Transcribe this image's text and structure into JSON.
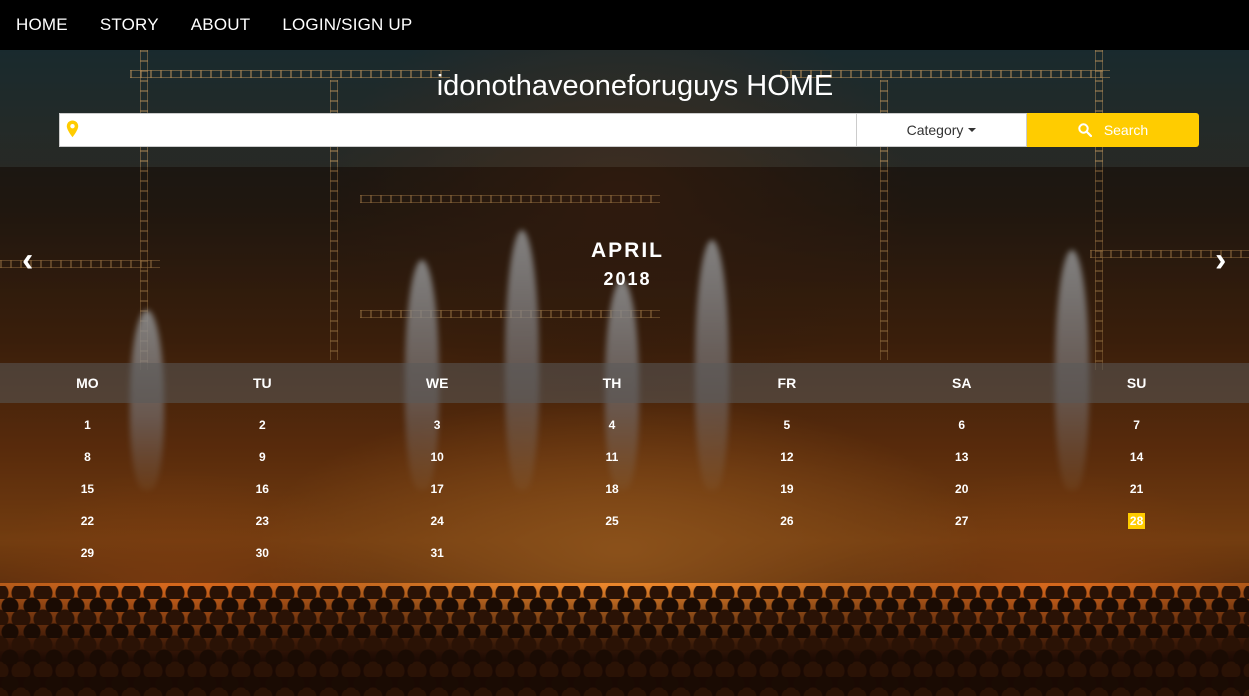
{
  "nav": {
    "items": [
      {
        "label": "HOME"
      },
      {
        "label": "STORY"
      },
      {
        "label": "ABOUT"
      },
      {
        "label": "LOGIN/SIGN UP"
      }
    ]
  },
  "header": {
    "title": "idonothaveoneforuguys HOME"
  },
  "search": {
    "value": "",
    "placeholder": "",
    "category_label": "Category",
    "button_label": "Search",
    "accent_color": "#ffcc00"
  },
  "calendar": {
    "month": "APRIL",
    "year": "2018",
    "prev_label": "‹",
    "next_label": "›",
    "weekdays": [
      "MO",
      "TU",
      "WE",
      "TH",
      "FR",
      "SA",
      "SU"
    ],
    "weeks": [
      [
        "1",
        "2",
        "3",
        "4",
        "5",
        "6",
        "7"
      ],
      [
        "8",
        "9",
        "10",
        "11",
        "12",
        "13",
        "14"
      ],
      [
        "15",
        "16",
        "17",
        "18",
        "19",
        "20",
        "21"
      ],
      [
        "22",
        "23",
        "24",
        "25",
        "26",
        "27",
        "28"
      ],
      [
        "29",
        "30",
        "31",
        "",
        "",
        "",
        ""
      ]
    ],
    "today": "28",
    "today_color": "#ffcc00"
  }
}
